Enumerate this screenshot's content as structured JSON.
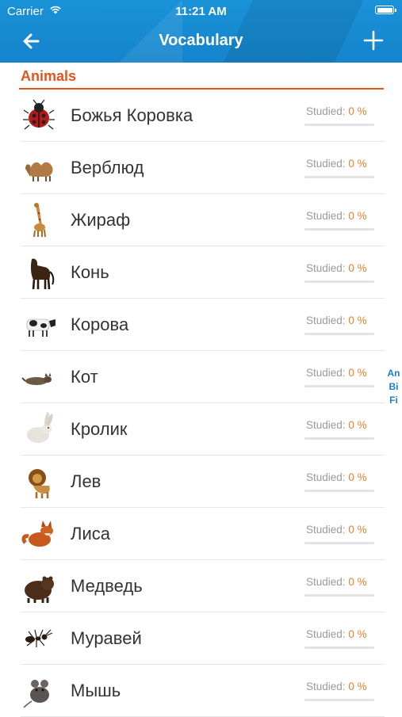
{
  "status_bar": {
    "carrier": "Carrier",
    "time": "11:21 AM"
  },
  "header": {
    "title": "Vocabulary",
    "back_icon": "arrow-left-icon",
    "add_icon": "plus-icon"
  },
  "section": {
    "title": "Animals"
  },
  "items": [
    {
      "word": "Божья Коровка",
      "studied_label": "Studied:",
      "percent": "0 %",
      "progress": 0,
      "icon": "ladybug"
    },
    {
      "word": "Верблюд",
      "studied_label": "Studied:",
      "percent": "0 %",
      "progress": 0,
      "icon": "camel"
    },
    {
      "word": "Жираф",
      "studied_label": "Studied:",
      "percent": "0 %",
      "progress": 0,
      "icon": "giraffe"
    },
    {
      "word": "Конь",
      "studied_label": "Studied:",
      "percent": "0 %",
      "progress": 0,
      "icon": "horse"
    },
    {
      "word": "Корова",
      "studied_label": "Studied:",
      "percent": "0 %",
      "progress": 0,
      "icon": "cow"
    },
    {
      "word": "Кот",
      "studied_label": "Studied:",
      "percent": "0 %",
      "progress": 0,
      "icon": "cat"
    },
    {
      "word": "Кролик",
      "studied_label": "Studied:",
      "percent": "0 %",
      "progress": 0,
      "icon": "rabbit"
    },
    {
      "word": "Лев",
      "studied_label": "Studied:",
      "percent": "0 %",
      "progress": 0,
      "icon": "lion"
    },
    {
      "word": "Лиса",
      "studied_label": "Studied:",
      "percent": "0 %",
      "progress": 0,
      "icon": "fox"
    },
    {
      "word": "Медведь",
      "studied_label": "Studied:",
      "percent": "0 %",
      "progress": 0,
      "icon": "bear"
    },
    {
      "word": "Муравей",
      "studied_label": "Studied:",
      "percent": "0 %",
      "progress": 0,
      "icon": "ant"
    },
    {
      "word": "Мышь",
      "studied_label": "Studied:",
      "percent": "0 %",
      "progress": 0,
      "icon": "mouse"
    }
  ],
  "section_index": [
    "An",
    "Bi",
    "Fi"
  ],
  "colors": {
    "header": "#1a92d8",
    "accent": "#e8521b",
    "percent": "#f07d2c",
    "index": "#1a7fcf"
  }
}
